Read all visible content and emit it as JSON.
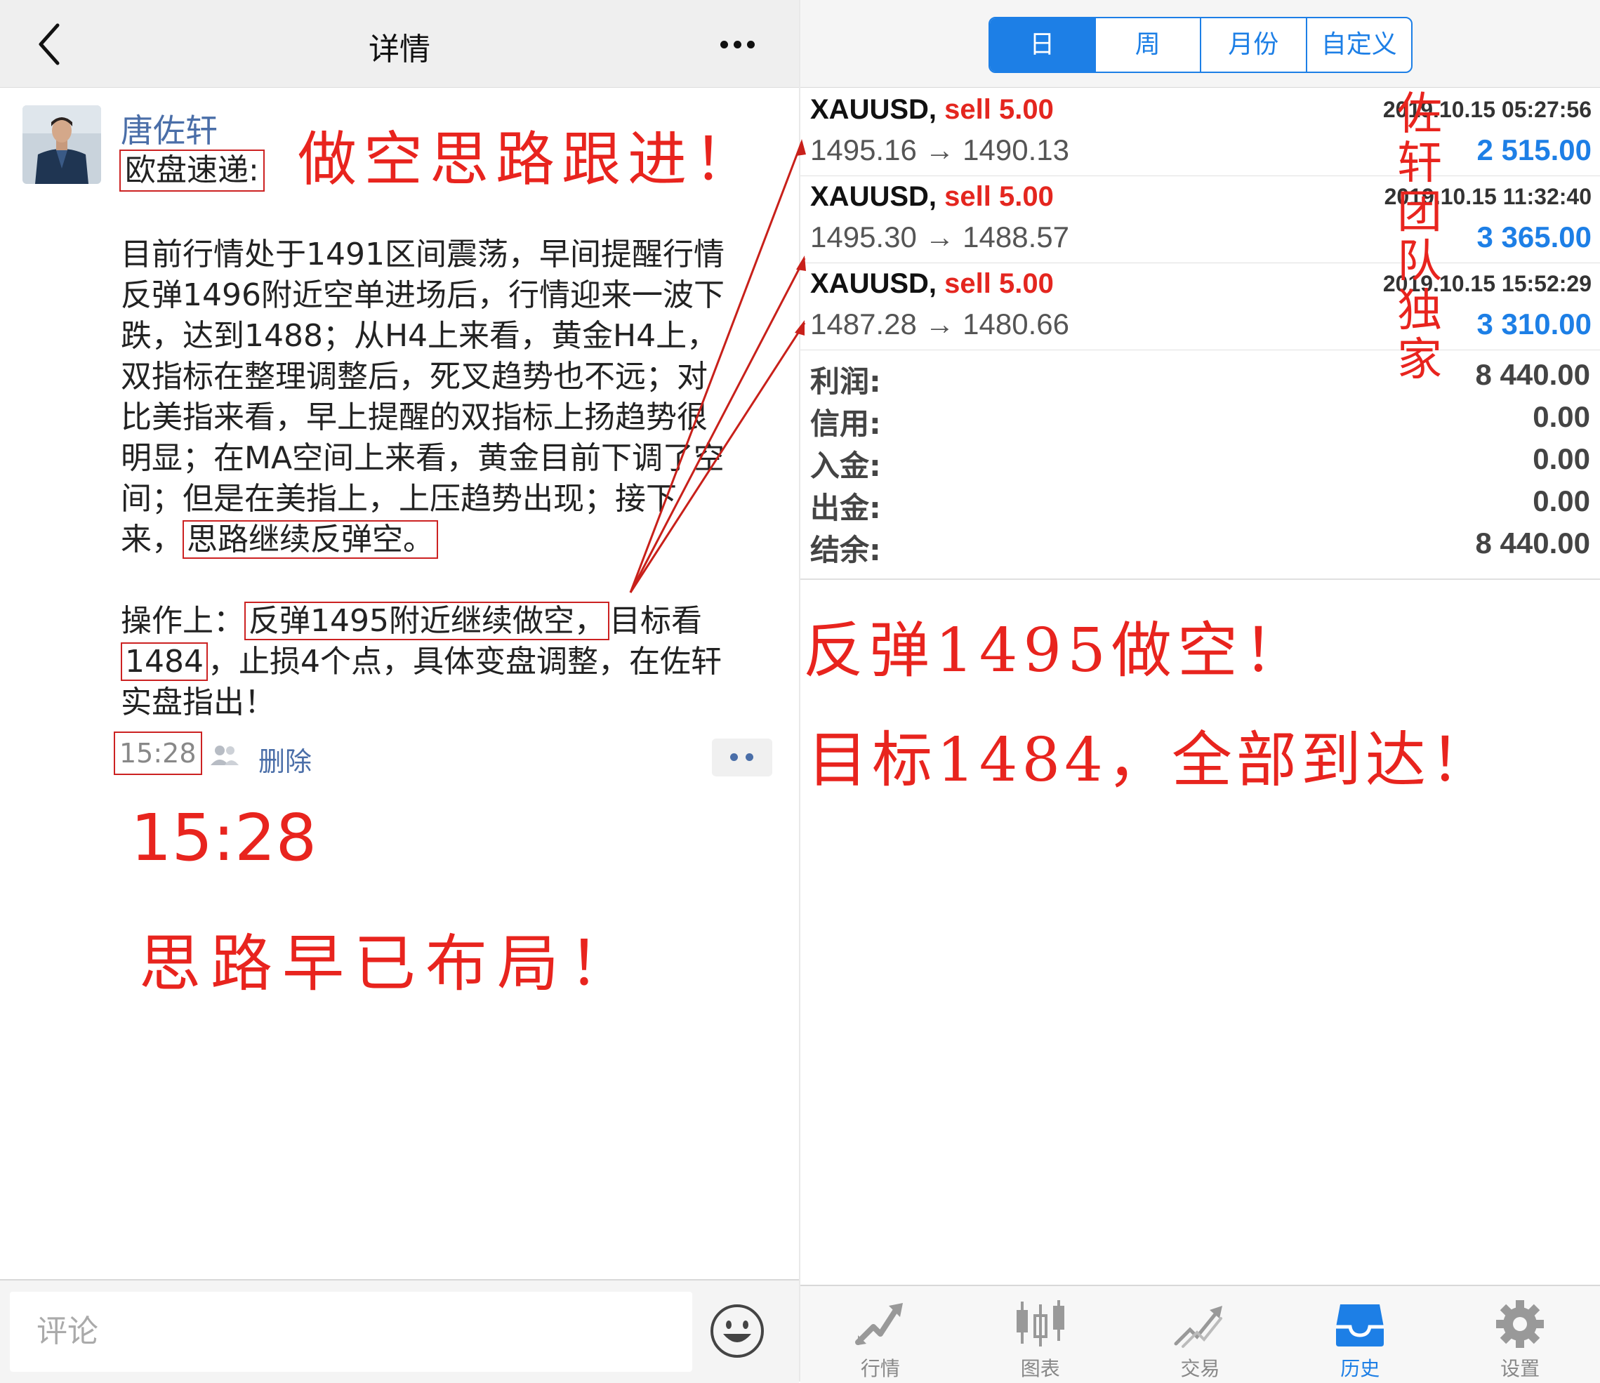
{
  "left": {
    "header": {
      "title": "详情"
    },
    "post": {
      "user_name": "唐佐轩",
      "sub_title": "欧盘速递:",
      "para1_line1": "  目前行情处于1491区间震荡，早间提醒行情",
      "para1_line2": "反弹1496附近空单进场后，行情迎来一波下",
      "para1_line3": "跌，达到1488；从H4上来看，黄金H4上，",
      "para1_line4": "双指标在整理调整后，死叉趋势也不远；对",
      "para1_line5": "比美指来看，早上提醒的双指标上扬趋势很",
      "para1_line6": "明显；在MA空间上来看，黄金目前下调了空",
      "para1_line7": "间；但是在美指上，上压趋势出现；接下",
      "para1_line8_pre": "来，",
      "para1_line8_box": "思路继续反弹空。",
      "para2_line1_pre": "  操作上：",
      "para2_line1_box": "反弹1495附近继续做空，",
      "para2_line1_post": "目标看",
      "para2_line2_box": "1484",
      "para2_line2_post": "，止损4个点，具体变盘调整，在佐轩",
      "para2_line3": "实盘指出！",
      "time": "15:28",
      "delete_label": "删除"
    },
    "comment_placeholder": "评论",
    "annotations": {
      "headline": "做空思路跟进！",
      "time_big": "15:28",
      "footer": "思路早已布局！"
    }
  },
  "right": {
    "tabs": [
      {
        "label": "日",
        "active": true
      },
      {
        "label": "周",
        "active": false
      },
      {
        "label": "月份",
        "active": false
      },
      {
        "label": "自定义",
        "active": false
      }
    ],
    "trades": [
      {
        "symbol": "XAUUSD,",
        "side": "sell 5.00",
        "time": "2019.10.15 05:27:56",
        "open": "1495.16",
        "arrow": "→",
        "close": "1490.13",
        "profit": "2 515.00"
      },
      {
        "symbol": "XAUUSD,",
        "side": "sell 5.00",
        "time": "2019.10.15 11:32:40",
        "open": "1495.30",
        "arrow": "→",
        "close": "1488.57",
        "profit": "3 365.00"
      },
      {
        "symbol": "XAUUSD,",
        "side": "sell 5.00",
        "time": "2019.10.15 15:52:29",
        "open": "1487.28",
        "arrow": "→",
        "close": "1480.66",
        "profit": "3 310.00"
      }
    ],
    "summary": [
      {
        "label": "利润:",
        "value": "8 440.00"
      },
      {
        "label": "信用:",
        "value": "0.00"
      },
      {
        "label": "入金:",
        "value": "0.00"
      },
      {
        "label": "出金:",
        "value": "0.00"
      },
      {
        "label": "结余:",
        "value": "8 440.00"
      }
    ],
    "annotations": {
      "vertical": [
        "佐",
        "轩",
        "团",
        "队",
        "独",
        "家"
      ],
      "line1": "反弹1495做空！",
      "line2": "目标1484，全部到达！"
    },
    "nav": [
      {
        "label": "行情",
        "icon": "quotes-icon",
        "active": false
      },
      {
        "label": "图表",
        "icon": "chart-icon",
        "active": false
      },
      {
        "label": "交易",
        "icon": "trade-icon",
        "active": false
      },
      {
        "label": "历史",
        "icon": "history-icon",
        "active": true
      },
      {
        "label": "设置",
        "icon": "settings-icon",
        "active": false
      }
    ]
  },
  "colors": {
    "accent": "#1d7fe6",
    "annotation_red": "#e8241e",
    "sell_red": "#e4261f",
    "link_blue": "#4a6ea8"
  }
}
